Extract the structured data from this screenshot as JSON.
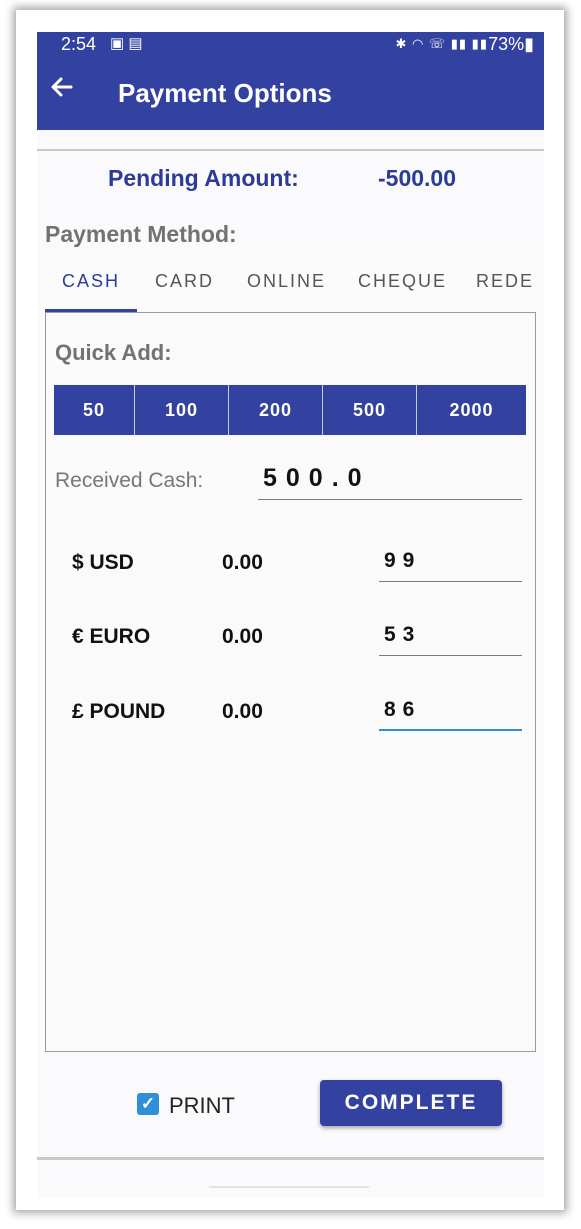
{
  "status_bar": {
    "time": "2:54",
    "battery": "73%",
    "icons": [
      "gallery-icon",
      "cast-icon",
      "bluetooth-icon",
      "wifi-icon",
      "call-icon",
      "signal-icon",
      "volte-icon",
      "signal-icon",
      "battery-icon"
    ]
  },
  "header": {
    "back_icon": "arrow-left-icon",
    "title": "Payment Options"
  },
  "pending": {
    "label": "Pending Amount:",
    "value": "-500.00"
  },
  "payment_method": {
    "label": "Payment Method:",
    "tabs": [
      "CASH",
      "CARD",
      "ONLINE",
      "CHEQUE",
      "REDEEM"
    ],
    "active_tab": "CASH"
  },
  "quick_add": {
    "label": "Quick Add:",
    "buttons": [
      "50",
      "100",
      "200",
      "500",
      "2000"
    ]
  },
  "received_cash": {
    "label": "Received Cash:",
    "value": "500.0"
  },
  "currencies": [
    {
      "name": "$ USD",
      "amount": "0.00",
      "input": "99"
    },
    {
      "name": "€ EURO",
      "amount": "0.00",
      "input": "53"
    },
    {
      "name": "£ POUND",
      "amount": "0.00",
      "input": "86"
    }
  ],
  "footer": {
    "print_label": "PRINT",
    "print_checked": true,
    "complete_label": "COMPLETE"
  },
  "colors": {
    "primary": "#3341a0",
    "accent": "#2f8fd8",
    "label_gray": "#727272"
  }
}
